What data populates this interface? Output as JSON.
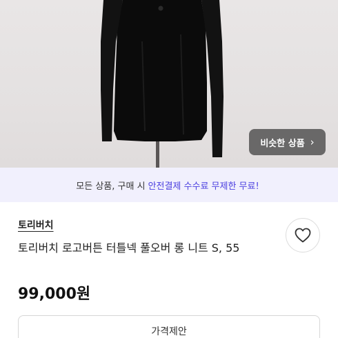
{
  "similar_button": {
    "label": "비슷한 상품",
    "chevron": "›"
  },
  "promo": {
    "prefix": "모든 상품, 구매 시",
    "highlight": "안전결제 수수료 무제한 무료!"
  },
  "product": {
    "store": "토리버치",
    "title": "토리버치 로고버튼 터틀넥 풀오버 롱 니트 S, 55",
    "price": "99,000원"
  },
  "offer_button": {
    "label": "가격제안"
  },
  "colors": {
    "accent": "#4b3fe0",
    "promo_bg": "#f1f0fd"
  },
  "icons": {
    "heart": "heart-outline-icon",
    "chevron": "chevron-right-icon"
  }
}
